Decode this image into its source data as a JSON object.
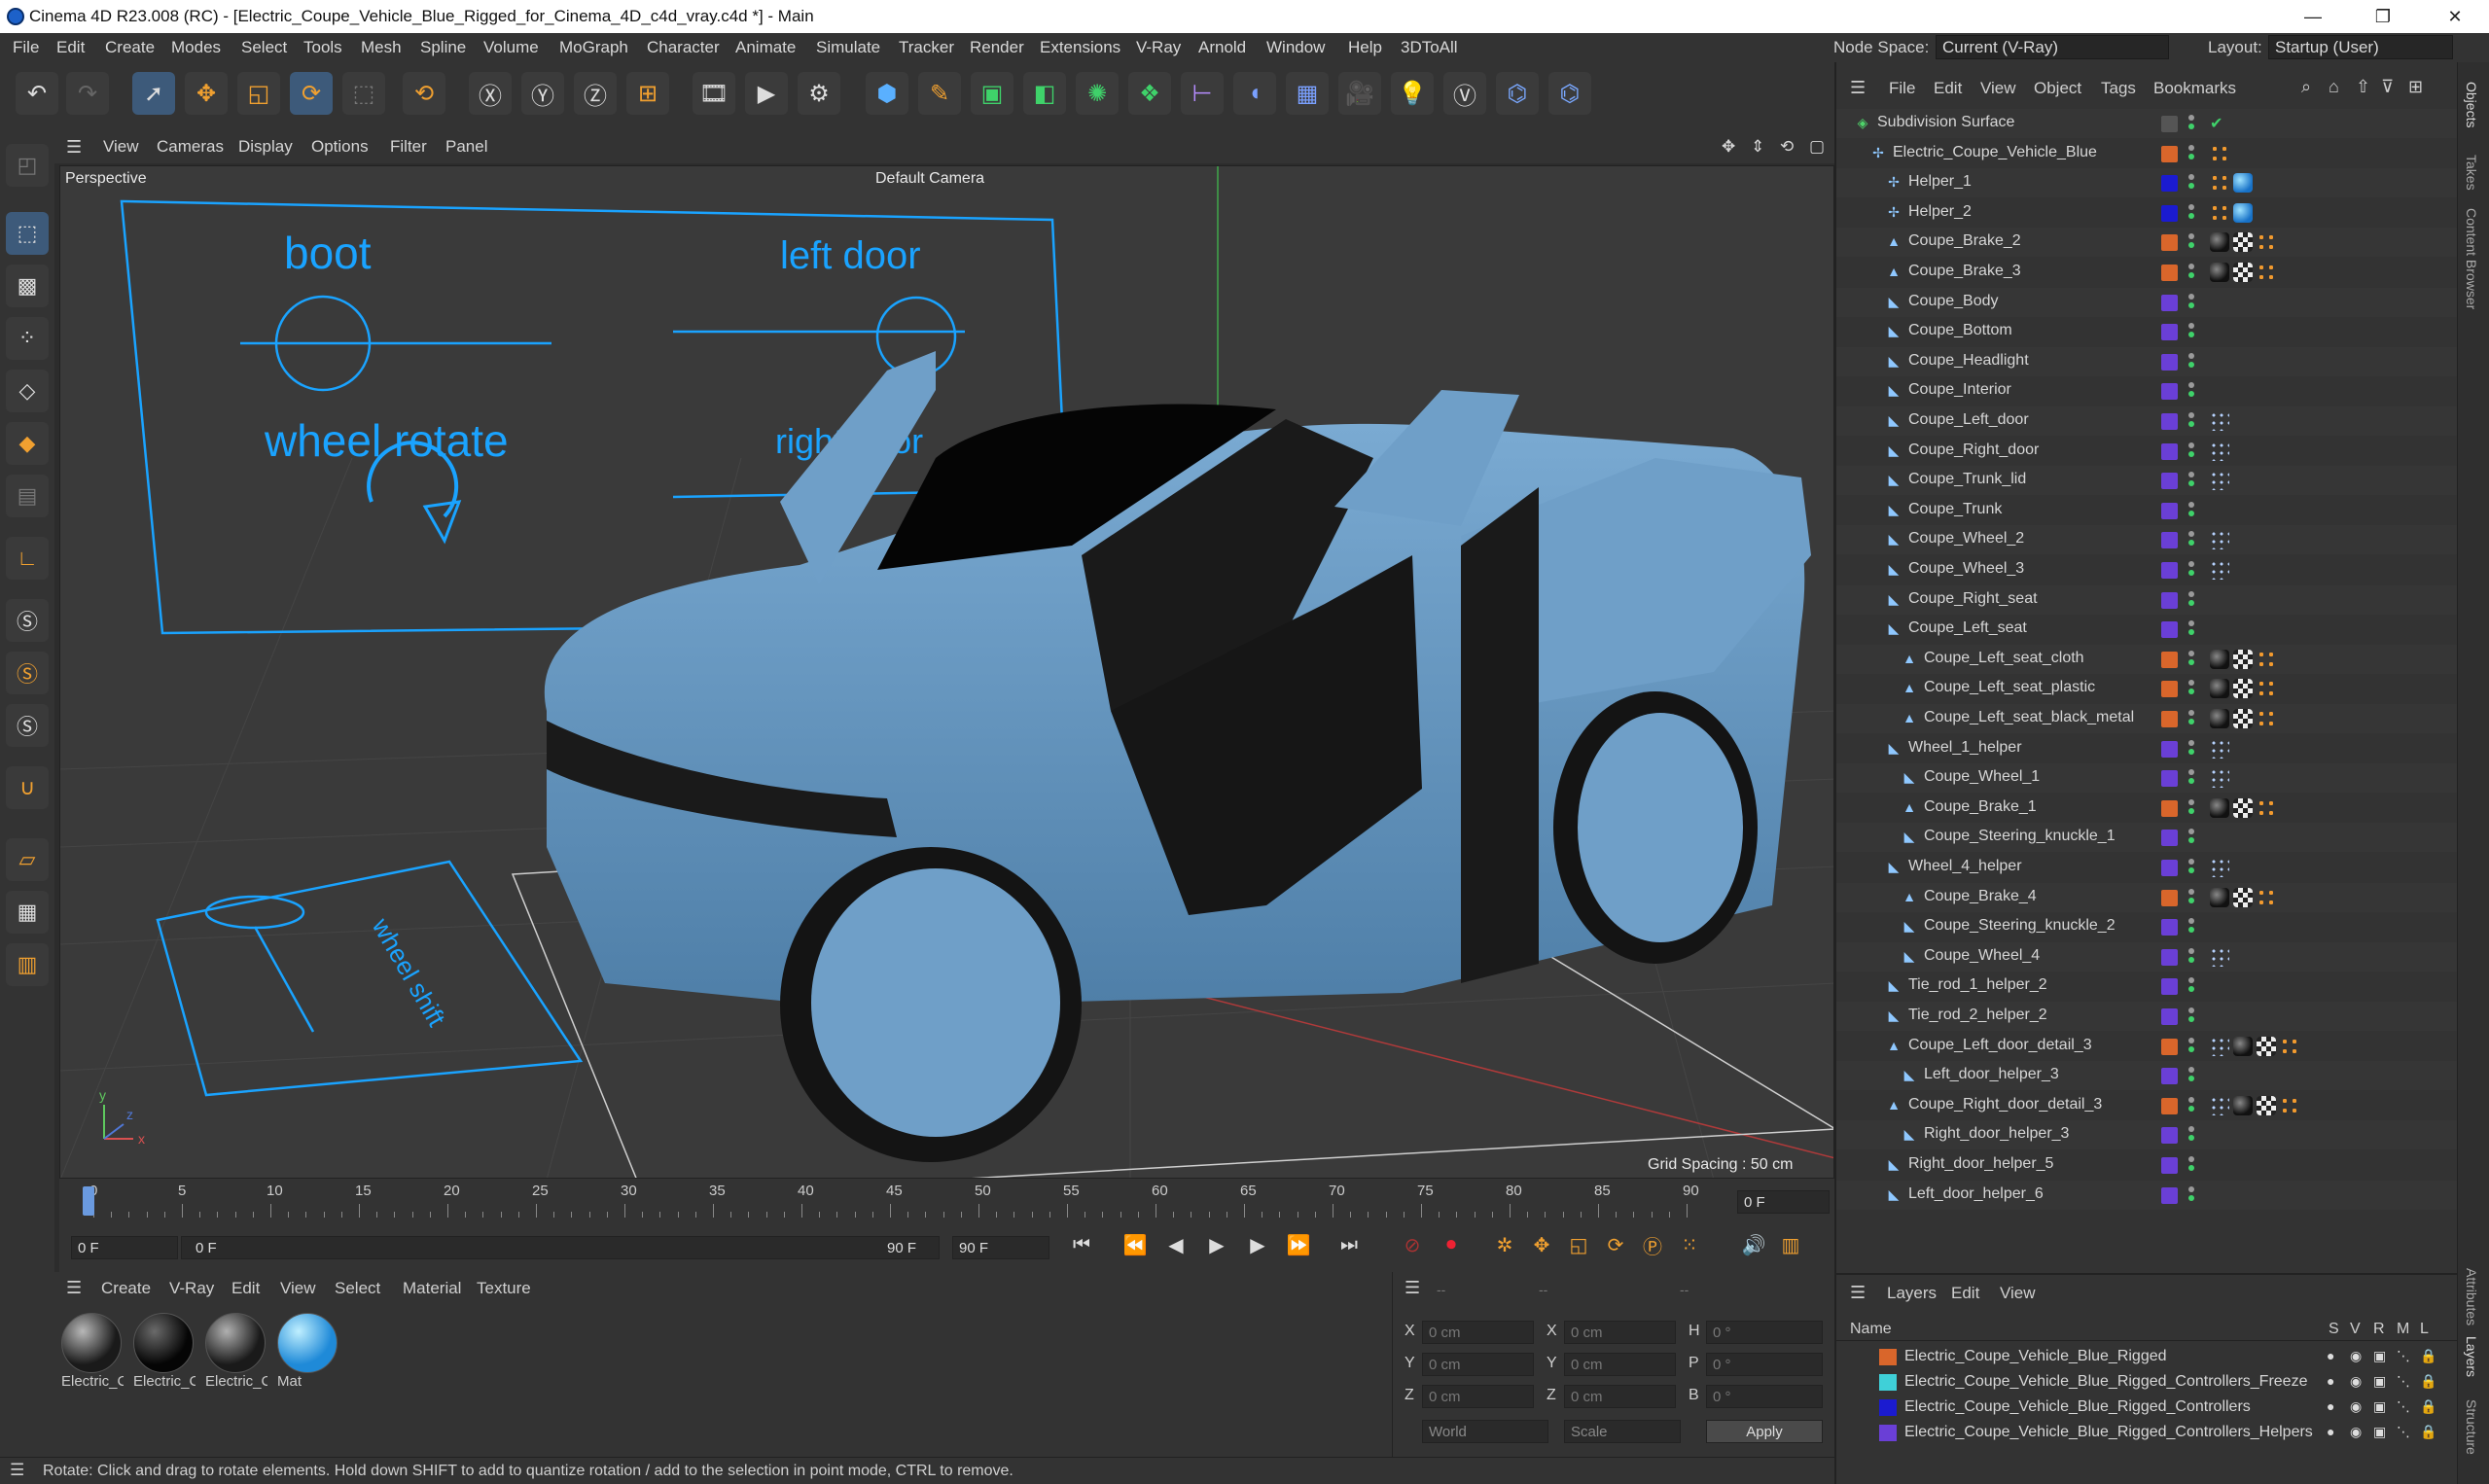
{
  "window": {
    "title": "Cinema 4D R23.008 (RC) - [Electric_Coupe_Vehicle_Blue_Rigged_for_Cinema_4D_c4d_vray.c4d *] - Main",
    "min": "—",
    "max": "❐",
    "close": "✕"
  },
  "menu": [
    "File",
    "Edit",
    "Create",
    "Modes",
    "Select",
    "Tools",
    "Mesh",
    "Spline",
    "Volume",
    "MoGraph",
    "Character",
    "Animate",
    "Simulate",
    "Tracker",
    "Render",
    "Extensions",
    "V-Ray",
    "Arnold",
    "Window",
    "Help",
    "3DToAll"
  ],
  "nodespace": {
    "label": "Node Space:",
    "value": "Current (V-Ray)"
  },
  "layout": {
    "label": "Layout:",
    "value": "Startup (User)"
  },
  "viewport": {
    "menu": [
      "View",
      "Cameras",
      "Display",
      "Options",
      "Filter",
      "Panel"
    ],
    "name": "Perspective",
    "camera": "Default Camera",
    "grid": "Grid Spacing : 50 cm",
    "labels": {
      "boot": "boot",
      "left_door": "left door",
      "wheel_rotate": "wheel rotate",
      "right_door": "right door",
      "floor": "wheel shift"
    },
    "axis": {
      "x": "x",
      "y": "y",
      "z": "z"
    },
    "colors": {
      "bg": "#3a3a3a",
      "car": "#6f9fc8",
      "rig": "#1aa3ff"
    }
  },
  "timeline": {
    "ticks": [
      "0",
      "5",
      "10",
      "15",
      "20",
      "25",
      "30",
      "35",
      "40",
      "45",
      "50",
      "55",
      "60",
      "65",
      "70",
      "75",
      "80",
      "85",
      "90"
    ],
    "frame": "0 F"
  },
  "transport": {
    "start": "0 F",
    "cur": "0 F",
    "end_in": "90 F",
    "end": "90 F"
  },
  "matmgr": {
    "menu": [
      "Create",
      "V-Ray",
      "Edit",
      "View",
      "Select",
      "Material",
      "Texture"
    ],
    "materials": [
      {
        "name": "Electric_Coupe",
        "kind": "dark"
      },
      {
        "name": "Electric_Coupe",
        "kind": "black"
      },
      {
        "name": "Electric_Coupe",
        "kind": "dark"
      },
      {
        "name": "Mat",
        "kind": "blue"
      }
    ]
  },
  "coords": {
    "x": "X",
    "y": "Y",
    "z": "Z",
    "h": "H",
    "p": "P",
    "b": "B",
    "val_cm": "0 cm",
    "val_deg": "0 °",
    "sep": "--",
    "world": "World",
    "scale": "Scale",
    "apply": "Apply"
  },
  "status": "Rotate: Click and drag to rotate elements. Hold down SHIFT to add to quantize rotation / add to the selection in point mode, CTRL to remove.",
  "objmgr": {
    "menu": [
      "File",
      "Edit",
      "View",
      "Object",
      "Tags",
      "Bookmarks"
    ],
    "rows": [
      {
        "name": "Subdivision Surface",
        "lvl": 0,
        "icon": "subdiv",
        "sw": "",
        "tags": [
          "check"
        ]
      },
      {
        "name": "Electric_Coupe_Vehicle_Blue",
        "lvl": 1,
        "icon": "null",
        "sw": "#d9662b",
        "tags": [
          "org"
        ]
      },
      {
        "name": "Helper_1",
        "lvl": 2,
        "icon": "null",
        "sw": "#1b1bd0",
        "tags": [
          "org",
          "blue"
        ]
      },
      {
        "name": "Helper_2",
        "lvl": 2,
        "icon": "null",
        "sw": "#1b1bd0",
        "tags": [
          "org",
          "blue"
        ]
      },
      {
        "name": "Coupe_Brake_2",
        "lvl": 2,
        "icon": "mesh",
        "sw": "#d9662b",
        "tags": [
          "mat",
          "chk",
          "org"
        ]
      },
      {
        "name": "Coupe_Brake_3",
        "lvl": 2,
        "icon": "mesh",
        "sw": "#d9662b",
        "tags": [
          "mat",
          "chk",
          "org"
        ]
      },
      {
        "name": "Coupe_Body",
        "lvl": 2,
        "icon": "poly",
        "sw": "#6a3fd6",
        "tags": []
      },
      {
        "name": "Coupe_Bottom",
        "lvl": 2,
        "icon": "poly",
        "sw": "#6a3fd6",
        "tags": []
      },
      {
        "name": "Coupe_Headlight",
        "lvl": 2,
        "icon": "poly",
        "sw": "#6a3fd6",
        "tags": []
      },
      {
        "name": "Coupe_Interior",
        "lvl": 2,
        "icon": "poly",
        "sw": "#6a3fd6",
        "tags": []
      },
      {
        "name": "Coupe_Left_door",
        "lvl": 2,
        "icon": "poly",
        "sw": "#6a3fd6",
        "tags": [
          "ctr"
        ]
      },
      {
        "name": "Coupe_Right_door",
        "lvl": 2,
        "icon": "poly",
        "sw": "#6a3fd6",
        "tags": [
          "ctr"
        ]
      },
      {
        "name": "Coupe_Trunk_lid",
        "lvl": 2,
        "icon": "poly",
        "sw": "#6a3fd6",
        "tags": [
          "ctr"
        ]
      },
      {
        "name": "Coupe_Trunk",
        "lvl": 2,
        "icon": "poly",
        "sw": "#6a3fd6",
        "tags": []
      },
      {
        "name": "Coupe_Wheel_2",
        "lvl": 2,
        "icon": "poly",
        "sw": "#6a3fd6",
        "tags": [
          "ctr"
        ]
      },
      {
        "name": "Coupe_Wheel_3",
        "lvl": 2,
        "icon": "poly",
        "sw": "#6a3fd6",
        "tags": [
          "ctr"
        ]
      },
      {
        "name": "Coupe_Right_seat",
        "lvl": 2,
        "icon": "poly",
        "sw": "#6a3fd6",
        "tags": []
      },
      {
        "name": "Coupe_Left_seat",
        "lvl": 2,
        "icon": "poly",
        "sw": "#6a3fd6",
        "tags": []
      },
      {
        "name": "Coupe_Left_seat_cloth",
        "lvl": 3,
        "icon": "mesh",
        "sw": "#d9662b",
        "tags": [
          "mat",
          "chk",
          "org"
        ]
      },
      {
        "name": "Coupe_Left_seat_plastic",
        "lvl": 3,
        "icon": "mesh",
        "sw": "#d9662b",
        "tags": [
          "mat",
          "chk",
          "org"
        ]
      },
      {
        "name": "Coupe_Left_seat_black_metal",
        "lvl": 3,
        "icon": "mesh",
        "sw": "#d9662b",
        "tags": [
          "mat",
          "chk",
          "org"
        ]
      },
      {
        "name": "Wheel_1_helper",
        "lvl": 2,
        "icon": "poly",
        "sw": "#6a3fd6",
        "tags": [
          "ctr"
        ]
      },
      {
        "name": "Coupe_Wheel_1",
        "lvl": 3,
        "icon": "poly",
        "sw": "#6a3fd6",
        "tags": [
          "ctr"
        ]
      },
      {
        "name": "Coupe_Brake_1",
        "lvl": 3,
        "icon": "mesh",
        "sw": "#d9662b",
        "tags": [
          "mat",
          "chk",
          "org"
        ]
      },
      {
        "name": "Coupe_Steering_knuckle_1",
        "lvl": 3,
        "icon": "poly",
        "sw": "#6a3fd6",
        "tags": []
      },
      {
        "name": "Wheel_4_helper",
        "lvl": 2,
        "icon": "poly",
        "sw": "#6a3fd6",
        "tags": [
          "ctr"
        ]
      },
      {
        "name": "Coupe_Brake_4",
        "lvl": 3,
        "icon": "mesh",
        "sw": "#d9662b",
        "tags": [
          "mat",
          "chk",
          "org"
        ]
      },
      {
        "name": "Coupe_Steering_knuckle_2",
        "lvl": 3,
        "icon": "poly",
        "sw": "#6a3fd6",
        "tags": []
      },
      {
        "name": "Coupe_Wheel_4",
        "lvl": 3,
        "icon": "poly",
        "sw": "#6a3fd6",
        "tags": [
          "ctr"
        ]
      },
      {
        "name": "Tie_rod_1_helper_2",
        "lvl": 2,
        "icon": "poly",
        "sw": "#6a3fd6",
        "tags": []
      },
      {
        "name": "Tie_rod_2_helper_2",
        "lvl": 2,
        "icon": "poly",
        "sw": "#6a3fd6",
        "tags": []
      },
      {
        "name": "Coupe_Left_door_detail_3",
        "lvl": 2,
        "icon": "mesh",
        "sw": "#d9662b",
        "tags": [
          "ctr",
          "mat",
          "chk",
          "org"
        ]
      },
      {
        "name": "Left_door_helper_3",
        "lvl": 3,
        "icon": "poly",
        "sw": "#6a3fd6",
        "tags": []
      },
      {
        "name": "Coupe_Right_door_detail_3",
        "lvl": 2,
        "icon": "mesh",
        "sw": "#d9662b",
        "tags": [
          "ctr",
          "mat",
          "chk",
          "org"
        ]
      },
      {
        "name": "Right_door_helper_3",
        "lvl": 3,
        "icon": "poly",
        "sw": "#6a3fd6",
        "tags": []
      },
      {
        "name": "Right_door_helper_5",
        "lvl": 2,
        "icon": "poly",
        "sw": "#6a3fd6",
        "tags": []
      },
      {
        "name": "Left_door_helper_6",
        "lvl": 2,
        "icon": "poly",
        "sw": "#6a3fd6",
        "tags": []
      }
    ]
  },
  "layermgr": {
    "menu": [
      "Layers",
      "Edit",
      "View"
    ],
    "header": {
      "name": "Name",
      "cols": [
        "S",
        "V",
        "R",
        "M",
        "L"
      ]
    },
    "rows": [
      {
        "name": "Electric_Coupe_Vehicle_Blue_Rigged",
        "color": "#d9662b"
      },
      {
        "name": "Electric_Coupe_Vehicle_Blue_Rigged_Controllers_Freeze",
        "color": "#3fd0d8"
      },
      {
        "name": "Electric_Coupe_Vehicle_Blue_Rigged_Controllers",
        "color": "#1b1bd0"
      },
      {
        "name": "Electric_Coupe_Vehicle_Blue_Rigged_Controllers_Helpers",
        "color": "#6a3fd6"
      }
    ]
  },
  "rightstrip": [
    "Objects",
    "Takes",
    "Content Browser",
    "Attributes",
    "Layers",
    "Structure"
  ]
}
